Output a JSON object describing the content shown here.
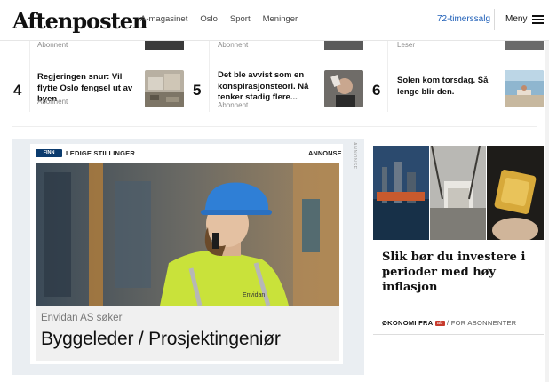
{
  "header": {
    "logo": "Aftenposten",
    "nav": [
      "A-magasinet",
      "Oslo",
      "Sport",
      "Meninger"
    ],
    "subscribe": "72-timerssalg",
    "menu": "Meny"
  },
  "peek": {
    "left_meta": "Abonnent",
    "mid_meta": "Abonnent",
    "right_meta": "Leser"
  },
  "ranked": [
    {
      "num": "4",
      "title": "Regjeringen snur: Vil flytte Oslo fengsel ut av byen",
      "meta": "Abonnent"
    },
    {
      "num": "5",
      "title": "Det ble avvist som en konspirasjonsteori. Nå tenker stadig flere...",
      "meta": "Abonnent"
    },
    {
      "num": "6",
      "title": "Solen kom torsdag. Så lenge blir den.",
      "meta": ""
    }
  ],
  "ad": {
    "finn": "FINN",
    "label": "LEDIGE STILLINGER",
    "annonse": "ANNONSE",
    "side": "ANNONSE",
    "helmet_brand": "Envidan",
    "company": "Envidan AS søker",
    "title": "Byggeleder / Prosjektingeniør"
  },
  "article": {
    "title": "Slik bør du investere i perioder med høy inflasjon",
    "section": "ØKONOMI FRA",
    "badge": "ab",
    "access": "/ FOR ABONNENTER"
  },
  "colors": {
    "link": "#1f5fb8",
    "finn": "#0b3b6e",
    "ad_bg": "#eaeef2"
  }
}
